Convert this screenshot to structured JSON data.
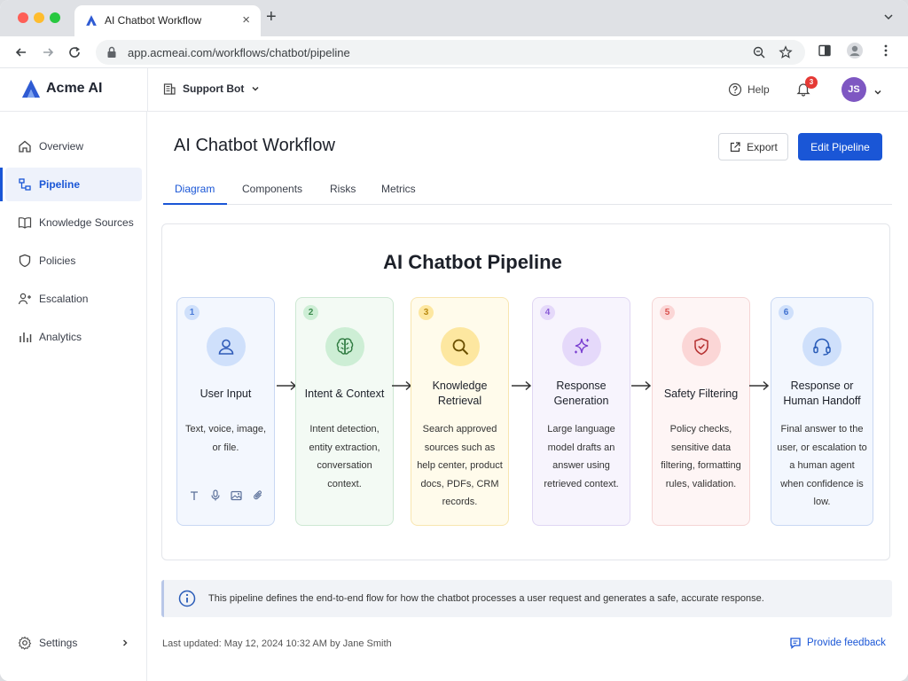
{
  "browser": {
    "tab_title": "AI Chatbot Workflow",
    "url": "app.acmeai.com/workflows/chatbot/pipeline"
  },
  "header": {
    "brand": "Acme AI",
    "workspace": "Support Bot",
    "help": "Help",
    "notification_count": "3",
    "avatar_initials": "JS"
  },
  "sidebar": {
    "items": [
      {
        "label": "Overview",
        "icon": "home-icon"
      },
      {
        "label": "Pipeline",
        "icon": "pipeline-icon",
        "active": true
      },
      {
        "label": "Knowledge Sources",
        "icon": "book-icon"
      },
      {
        "label": "Policies",
        "icon": "shield-icon"
      },
      {
        "label": "Escalation",
        "icon": "escalation-icon"
      },
      {
        "label": "Analytics",
        "icon": "bar-chart-icon"
      }
    ],
    "settings": "Settings"
  },
  "page": {
    "title": "AI Chatbot Workflow",
    "export_label": "Export",
    "edit_label": "Edit Pipeline",
    "tabs": [
      "Diagram",
      "Components",
      "Risks",
      "Metrics"
    ],
    "active_tab": "Diagram"
  },
  "diagram": {
    "title": "AI Chatbot Pipeline",
    "steps": [
      {
        "num": "1",
        "title": "User Input",
        "desc": "Text, voice, image, or file.",
        "icon": "user-icon",
        "color": "#4a7bd8",
        "bg": "#f3f7fe",
        "border": "#c9d8f3",
        "circle": "#cfe0fb"
      },
      {
        "num": "2",
        "title": "Intent & Context",
        "desc": "Intent detection, entity extraction, conversation context.",
        "icon": "brain-icon",
        "color": "#3d8b4e",
        "bg": "#f3faf4",
        "border": "#cde8d3",
        "circle": "#cdeed5"
      },
      {
        "num": "3",
        "title": "Knowledge Retrieval",
        "desc": "Search approved sources such as help center, product docs, PDFs, CRM records.",
        "icon": "search-icon",
        "color": "#b98a10",
        "bg": "#fffbeb",
        "border": "#f8e6b0",
        "circle": "#fde7a0"
      },
      {
        "num": "4",
        "title": "Response Generation",
        "desc": "Large language model drafts an answer using retrieved context.",
        "icon": "sparkle-icon",
        "color": "#8a5cd6",
        "bg": "#f7f4fd",
        "border": "#e0d6f3",
        "circle": "#e5d9fa"
      },
      {
        "num": "5",
        "title": "Safety Filtering",
        "desc": "Policy checks, sensitive data filtering, formatting rules, validation.",
        "icon": "shield-check-icon",
        "color": "#d9534f",
        "bg": "#fef5f5",
        "border": "#f5d5d5",
        "circle": "#fbd6d6"
      },
      {
        "num": "6",
        "title": "Response or Human Handoff",
        "desc": "Final answer to the user, or escalation to a human agent when confidence is low.",
        "icon": "headset-icon",
        "color": "#3d6fcf",
        "bg": "#f3f7fe",
        "border": "#c9d8f3",
        "circle": "#cfe0fb"
      }
    ],
    "input_icons": [
      "text-icon",
      "microphone-icon",
      "image-icon",
      "attachment-icon"
    ]
  },
  "info": "This pipeline defines the end-to-end flow for how the chatbot processes a user request and generates a safe, accurate response.",
  "footer": {
    "last_updated": "Last updated: May 12, 2024 10:32 AM by Jane Smith",
    "feedback": "Provide feedback"
  },
  "colors": {
    "accent": "#1a56d6",
    "badge": "#e53935",
    "avatar": "#7e57c2"
  }
}
